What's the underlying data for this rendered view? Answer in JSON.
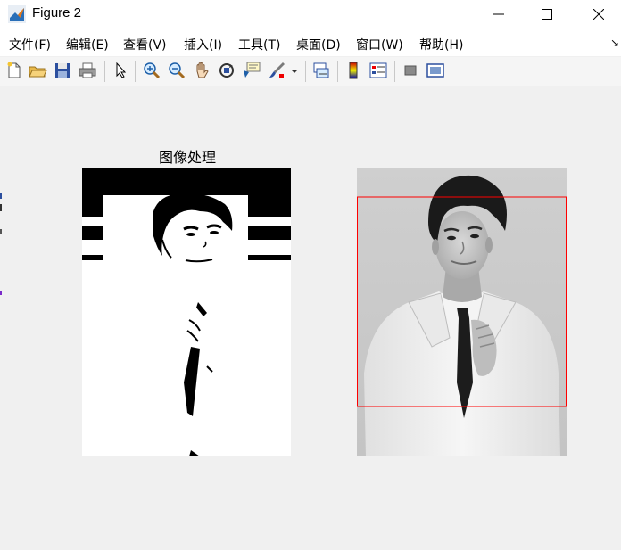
{
  "window": {
    "title": "Figure 2",
    "controls": [
      "minimize",
      "maximize",
      "close"
    ]
  },
  "menubar": {
    "items": [
      {
        "label": "文件(F)"
      },
      {
        "label": "编辑(E)"
      },
      {
        "label": "查看(V)"
      },
      {
        "label": "插入(I)"
      },
      {
        "label": "工具(T)"
      },
      {
        "label": "桌面(D)"
      },
      {
        "label": "窗口(W)"
      },
      {
        "label": "帮助(H)"
      }
    ]
  },
  "toolbar": {
    "icons": [
      "new-figure-icon",
      "open-file-icon",
      "save-icon",
      "print-icon",
      "select-arrow-icon",
      "zoom-in-icon",
      "zoom-out-icon",
      "pan-hand-icon",
      "rotate-3d-icon",
      "data-cursor-icon",
      "brush-icon",
      "link-plot-icon",
      "colorbar-icon",
      "legend-icon",
      "hide-plot-tools-icon",
      "show-plot-tools-icon"
    ]
  },
  "figure": {
    "left_axes": {
      "title": "图像处理",
      "content": "binary-thresholded-portrait"
    },
    "right_axes": {
      "content": "grayscale-portrait",
      "face_box_color": "#ff0000"
    }
  },
  "colors": {
    "figure_bg": "#f0f0f0",
    "highlight_rect": "#ff0000"
  }
}
